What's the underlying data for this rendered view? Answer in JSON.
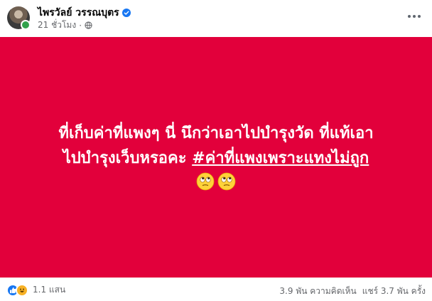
{
  "post": {
    "author": "ไพรวัลย์ วรรณบุตร",
    "time": "21 ชั่วโมง",
    "text_line1": "ที่เก็บค่าที่แพงๆ นี่ นึกว่าเอาไปบำรุงวัด ที่แท้เอา",
    "text_line2_plain": "ไปบำรุงเว็บหรอคะ ",
    "hashtag": "#ค่าที่แพงเพราะแทงไม่ถูก",
    "background_color": "#e2003b",
    "emojis": [
      "face-with-rolling-eyes-icon",
      "face-with-rolling-eyes-icon"
    ]
  },
  "footer": {
    "reaction_count": "1.1 แสน",
    "comments": "3.9 พัน ความคิดเห็น",
    "shares": "แชร์ 3.7 พัน ครั้ง"
  }
}
